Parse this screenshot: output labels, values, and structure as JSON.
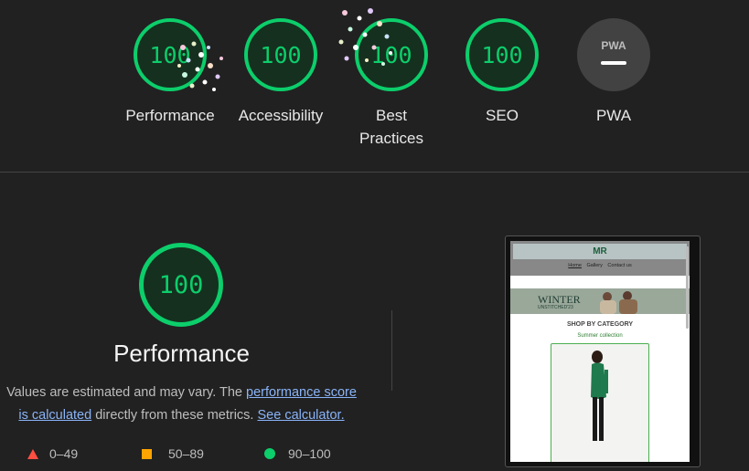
{
  "categories": [
    {
      "score": "100",
      "label": "Performance"
    },
    {
      "score": "100",
      "label": "Accessibility"
    },
    {
      "score": "100",
      "label": "Best Practices"
    },
    {
      "score": "100",
      "label": "SEO"
    },
    {
      "score": "",
      "label": "PWA",
      "badge": "PWA"
    }
  ],
  "performance": {
    "score": "100",
    "title": "Performance",
    "desc_prefix": "Values are estimated and may vary. The ",
    "link_score": "performance score is calculated",
    "desc_middle": " directly from these metrics. ",
    "link_calc": "See calculator."
  },
  "legend": {
    "fail": "0–49",
    "average": "50–89",
    "pass": "90–100"
  },
  "screenshot": {
    "logo": "MR",
    "nav": [
      "Home",
      "Gallery",
      "Contact us"
    ],
    "banner_title": "WINTER",
    "banner_sub": "UNSTITCHED'23",
    "category_heading": "SHOP BY CATEGORY",
    "collection": "Summer collection"
  },
  "colors": {
    "pass": "#0cce6b",
    "average": "#ffa400",
    "fail": "#ff4e42",
    "background": "#212121"
  }
}
